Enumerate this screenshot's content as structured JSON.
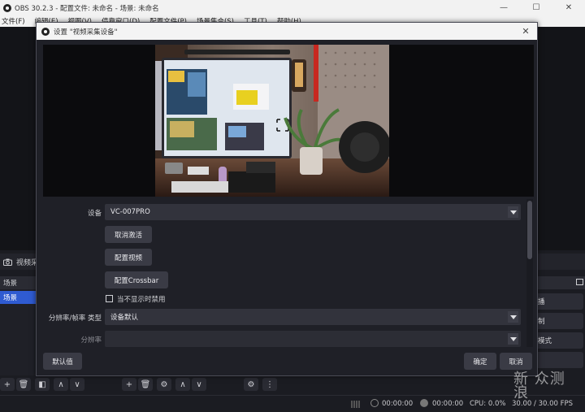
{
  "app": {
    "title": "OBS 30.2.3 - 配置文件: 未命名 - 场景: 未命名",
    "menu": [
      "文件(F)",
      "编辑(E)",
      "视图(V)",
      "停靠窗口(D)",
      "配置文件(P)",
      "场景集合(S)",
      "工具(T)",
      "帮助(H)"
    ]
  },
  "sources_bar": {
    "label": "视频采"
  },
  "scenes": {
    "header": "场景",
    "items": [
      "场景"
    ]
  },
  "right_controls": [
    "播",
    "制",
    "模式"
  ],
  "status": {
    "rec_time_1": "00:00:00",
    "rec_time_2": "00:00:00",
    "cpu": "CPU: 0.0%",
    "fps": "30.00 / 30.00 FPS"
  },
  "dialog": {
    "title": "设置 \"视频采集设备\"",
    "device_label": "设备",
    "device_value": "VC-007PRO",
    "btn_deactivate": "取消激活",
    "btn_config_video": "配置视频",
    "btn_config_crossbar": "配置Crossbar",
    "checkbox_label": "当不显示时禁用",
    "checkbox_checked": false,
    "res_type_label": "分辨率/帧率 类型",
    "res_type_value": "设备默认",
    "resolution_label": "分辨率",
    "resolution_value": "",
    "btn_defaults": "默认值",
    "btn_ok": "确定",
    "btn_cancel": "取消"
  },
  "watermark": "新 众测\n浪"
}
